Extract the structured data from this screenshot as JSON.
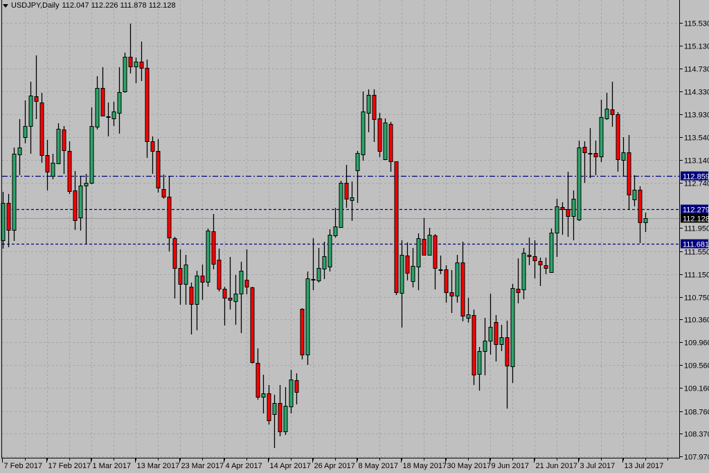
{
  "header": {
    "symbol_timeframe": "USDJPY,Daily",
    "ohlc_text": "112.047 112.226 111.878 112.128"
  },
  "chart_data": {
    "type": "candlestick",
    "symbol": "USDJPY",
    "timeframe": "Daily",
    "ylim": [
      107.97,
      115.53
    ],
    "grid": true,
    "colors": {
      "background": "#c0c0c0",
      "bull": "#2da56a",
      "bear": "#ff0000",
      "wick": "#000000",
      "grid": "#a6a6a6",
      "level_line": "#000080",
      "current_price_line": "#9a9a9a"
    },
    "y_tick_labels": [
      "115.530",
      "115.130",
      "114.730",
      "114.330",
      "113.930",
      "113.540",
      "113.140",
      "112.740",
      "111.950",
      "111.550",
      "111.150",
      "110.750",
      "110.360",
      "109.960",
      "109.560",
      "109.160",
      "108.760",
      "108.370",
      "107.970"
    ],
    "x_tick_labels": [
      {
        "bar": 0,
        "label": "7 Feb 2017"
      },
      {
        "bar": 8,
        "label": "17 Feb 2017"
      },
      {
        "bar": 16,
        "label": "1 Mar 2017"
      },
      {
        "bar": 24,
        "label": "13 Mar 2017"
      },
      {
        "bar": 32,
        "label": "23 Mar 2017"
      },
      {
        "bar": 40,
        "label": "4 Apr 2017"
      },
      {
        "bar": 48,
        "label": "14 Apr 2017"
      },
      {
        "bar": 56,
        "label": "26 Apr 2017"
      },
      {
        "bar": 64,
        "label": "8 May 2017"
      },
      {
        "bar": 72,
        "label": "18 May 2017"
      },
      {
        "bar": 80,
        "label": "30 May 2017"
      },
      {
        "bar": 88,
        "label": "9 Jun 2017"
      },
      {
        "bar": 96,
        "label": "21 Jun 2017"
      },
      {
        "bar": 104,
        "label": "3 Jul 2017"
      },
      {
        "bar": 112,
        "label": "13 Jul 2017"
      }
    ],
    "levels": [
      {
        "price": 112.859,
        "label": "112.859",
        "style": "dash-dot"
      },
      {
        "price": 112.279,
        "label": "112.279",
        "style": "dashed"
      },
      {
        "price": 111.681,
        "label": "111.681",
        "style": "dashed"
      }
    ],
    "current_price": {
      "price": 112.128,
      "label": "112.128"
    },
    "ohlc_fields": [
      "open",
      "high",
      "low",
      "close"
    ],
    "candles": [
      [
        111.74,
        112.58,
        111.59,
        112.39
      ],
      [
        112.39,
        112.55,
        111.62,
        111.92
      ],
      [
        111.92,
        113.36,
        111.73,
        113.25
      ],
      [
        113.23,
        113.85,
        112.87,
        113.36
      ],
      [
        113.54,
        114.18,
        113.43,
        113.73
      ],
      [
        113.73,
        114.5,
        113.25,
        114.26
      ],
      [
        114.25,
        114.96,
        113.85,
        114.17
      ],
      [
        114.14,
        114.31,
        113.09,
        113.22
      ],
      [
        113.22,
        113.49,
        112.61,
        112.93
      ],
      [
        112.86,
        113.25,
        112.8,
        113.09
      ],
      [
        113.08,
        113.78,
        113.07,
        113.68
      ],
      [
        113.67,
        113.73,
        112.9,
        113.31
      ],
      [
        113.3,
        113.46,
        112.55,
        112.59
      ],
      [
        112.61,
        112.95,
        111.92,
        112.09
      ],
      [
        112.14,
        112.85,
        111.91,
        112.69
      ],
      [
        112.69,
        112.9,
        111.68,
        112.74
      ],
      [
        112.74,
        114.06,
        112.72,
        113.73
      ],
      [
        113.72,
        114.6,
        113.67,
        114.39
      ],
      [
        114.39,
        114.76,
        113.9,
        113.91
      ],
      [
        113.9,
        114.14,
        113.55,
        113.89
      ],
      [
        113.86,
        114.15,
        113.73,
        113.98
      ],
      [
        113.96,
        114.76,
        113.6,
        114.32
      ],
      [
        114.33,
        115.01,
        114.31,
        114.94
      ],
      [
        114.94,
        115.52,
        114.65,
        114.77
      ],
      [
        114.77,
        114.93,
        114.48,
        114.85
      ],
      [
        114.85,
        115.2,
        114.52,
        114.75
      ],
      [
        114.75,
        114.89,
        113.17,
        113.46
      ],
      [
        113.46,
        113.55,
        112.9,
        113.3
      ],
      [
        113.3,
        113.5,
        112.57,
        112.66
      ],
      [
        112.63,
        112.88,
        112.46,
        112.5
      ],
      [
        112.5,
        112.86,
        111.54,
        111.79
      ],
      [
        111.77,
        111.8,
        110.72,
        111.25
      ],
      [
        111.25,
        111.58,
        110.61,
        110.98
      ],
      [
        110.98,
        111.48,
        110.61,
        111.31
      ],
      [
        110.93,
        111.0,
        110.09,
        110.63
      ],
      [
        110.63,
        111.21,
        110.17,
        111.12
      ],
      [
        111.12,
        111.31,
        110.7,
        111.01
      ],
      [
        111.01,
        111.94,
        110.93,
        111.91
      ],
      [
        111.89,
        112.2,
        111.23,
        111.33
      ],
      [
        111.4,
        111.59,
        110.84,
        110.89
      ],
      [
        110.89,
        110.93,
        110.25,
        110.73
      ],
      [
        110.73,
        111.45,
        110.53,
        110.7
      ],
      [
        110.67,
        111.13,
        110.27,
        110.81
      ],
      [
        110.81,
        111.36,
        110.12,
        111.21
      ],
      [
        111.05,
        111.58,
        110.8,
        110.93
      ],
      [
        110.92,
        110.93,
        109.59,
        109.61
      ],
      [
        109.6,
        109.86,
        108.96,
        109.01
      ],
      [
        109.01,
        109.39,
        108.72,
        109.07
      ],
      [
        109.07,
        109.21,
        108.52,
        108.6
      ],
      [
        108.71,
        109.04,
        108.11,
        108.9
      ],
      [
        108.9,
        109.21,
        108.32,
        108.4
      ],
      [
        108.4,
        109.18,
        108.35,
        108.85
      ],
      [
        108.84,
        109.48,
        108.72,
        109.31
      ],
      [
        109.3,
        109.42,
        108.87,
        109.09
      ],
      [
        110.54,
        110.55,
        109.66,
        109.74
      ],
      [
        109.74,
        111.19,
        109.57,
        111.07
      ],
      [
        111.05,
        111.77,
        110.87,
        111.06
      ],
      [
        111.04,
        111.6,
        111.0,
        111.25
      ],
      [
        111.24,
        111.71,
        111.06,
        111.46
      ],
      [
        111.28,
        111.93,
        111.19,
        111.83
      ],
      [
        111.82,
        112.3,
        111.79,
        111.98
      ],
      [
        111.97,
        112.78,
        111.96,
        112.74
      ],
      [
        112.74,
        113.05,
        112.3,
        112.46
      ],
      [
        112.44,
        112.76,
        112.08,
        112.49
      ],
      [
        112.96,
        113.3,
        112.39,
        113.26
      ],
      [
        113.23,
        114.33,
        113.13,
        113.98
      ],
      [
        113.96,
        114.37,
        113.62,
        114.27
      ],
      [
        114.27,
        114.37,
        113.45,
        113.85
      ],
      [
        113.86,
        113.96,
        113.19,
        113.3
      ],
      [
        113.15,
        113.86,
        113.14,
        113.79
      ],
      [
        113.77,
        113.8,
        112.93,
        113.11
      ],
      [
        113.11,
        113.12,
        110.78,
        110.83
      ],
      [
        110.82,
        111.74,
        110.22,
        111.48
      ],
      [
        111.47,
        111.7,
        111.04,
        111.17
      ],
      [
        111.02,
        111.6,
        110.92,
        111.29
      ],
      [
        111.28,
        111.86,
        110.87,
        111.77
      ],
      [
        111.76,
        112.12,
        111.47,
        111.48
      ],
      [
        111.48,
        111.95,
        111.47,
        111.83
      ],
      [
        111.82,
        111.85,
        110.88,
        111.25
      ],
      [
        111.23,
        111.47,
        111.15,
        111.22
      ],
      [
        111.23,
        111.3,
        110.65,
        110.83
      ],
      [
        110.83,
        111.22,
        110.47,
        110.77
      ],
      [
        110.77,
        111.48,
        110.65,
        111.35
      ],
      [
        111.35,
        111.71,
        110.32,
        110.42
      ],
      [
        110.38,
        110.73,
        110.3,
        110.44
      ],
      [
        110.43,
        110.53,
        109.21,
        109.39
      ],
      [
        109.41,
        109.88,
        109.12,
        109.8
      ],
      [
        109.8,
        110.38,
        109.38,
        109.99
      ],
      [
        109.99,
        110.81,
        109.74,
        110.23
      ],
      [
        110.31,
        110.43,
        109.62,
        109.93
      ],
      [
        109.93,
        110.26,
        109.8,
        110.05
      ],
      [
        110.05,
        110.34,
        108.8,
        109.55
      ],
      [
        109.54,
        110.98,
        109.25,
        110.9
      ],
      [
        110.89,
        111.42,
        110.64,
        110.83
      ],
      [
        110.88,
        111.6,
        110.71,
        111.52
      ],
      [
        111.48,
        111.79,
        111.3,
        111.46
      ],
      [
        111.46,
        111.74,
        111.07,
        111.39
      ],
      [
        111.37,
        111.43,
        110.94,
        111.31
      ],
      [
        111.3,
        111.43,
        111.15,
        111.25
      ],
      [
        111.18,
        111.94,
        111.17,
        111.87
      ],
      [
        111.87,
        112.46,
        111.45,
        112.33
      ],
      [
        112.32,
        112.4,
        111.83,
        112.28
      ],
      [
        112.28,
        112.93,
        111.8,
        112.16
      ],
      [
        112.16,
        112.61,
        111.74,
        112.46
      ],
      [
        112.1,
        113.48,
        112.08,
        113.36
      ],
      [
        113.37,
        113.46,
        112.74,
        113.27
      ],
      [
        113.26,
        113.69,
        112.82,
        113.26
      ],
      [
        113.26,
        113.48,
        112.87,
        113.2
      ],
      [
        113.2,
        114.19,
        113.1,
        113.89
      ],
      [
        113.86,
        114.31,
        113.84,
        114.03
      ],
      [
        114.02,
        114.5,
        113.72,
        113.94
      ],
      [
        113.94,
        113.97,
        112.93,
        113.15
      ],
      [
        113.14,
        113.54,
        112.86,
        113.27
      ],
      [
        113.27,
        113.57,
        112.27,
        112.53
      ],
      [
        112.45,
        112.87,
        112.33,
        112.62
      ],
      [
        112.62,
        112.68,
        111.69,
        112.05
      ],
      [
        112.047,
        112.226,
        111.878,
        112.128
      ]
    ]
  }
}
